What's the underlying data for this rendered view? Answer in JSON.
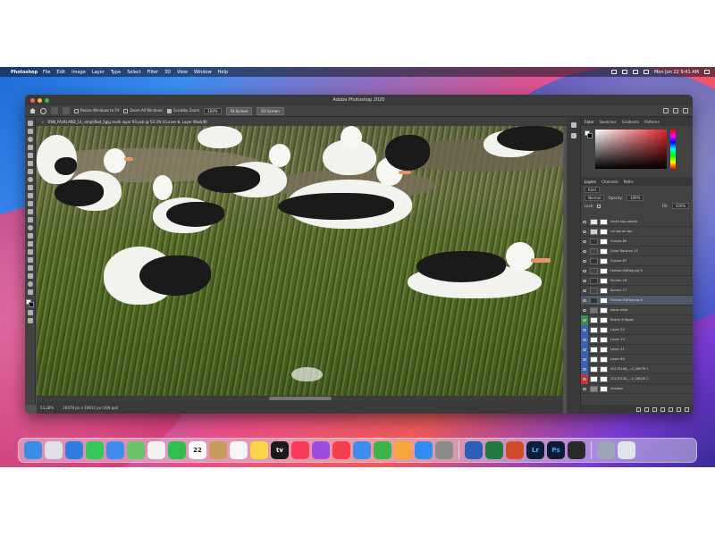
{
  "menubar": {
    "app_name": "Photoshop",
    "items": [
      "File",
      "Edit",
      "Image",
      "Layer",
      "Type",
      "Select",
      "Filter",
      "3D",
      "View",
      "Window",
      "Help"
    ],
    "clock": "Mon Jun 22  9:41 AM"
  },
  "window": {
    "title": "Adobe Photoshop 2020"
  },
  "options_bar": {
    "resize_windows": "Resize Windows to Fit",
    "zoom_all": "Zoom All Windows",
    "scrubby_zoom": "Scrubby Zoom",
    "zoom_level": "100%",
    "fit_screen": "Fit Screen",
    "fill_screen": "Fill Screen"
  },
  "document": {
    "tab_title": "DSN_FALKLAND_14_simplified_5gig multi layer 93.psb @ 53.3% (Curves 8, Layer Mask/8)",
    "status_zoom": "53.28%",
    "status_size": "20479 px x 10912 px (300 ppi)"
  },
  "color_panel": {
    "tabs": [
      "Color",
      "Swatches",
      "Gradients",
      "Patterns"
    ]
  },
  "layers_panel": {
    "tabs": [
      "Layers",
      "Channels",
      "Paths"
    ],
    "kind": "Kind",
    "blend_mode": "Normal",
    "opacity_label": "Opacity:",
    "opacity": "100%",
    "lock_label": "Lock:",
    "fill_label": "Fill:",
    "fill": "100%",
    "layers": [
      {
        "name": "small hop pieces",
        "color": "",
        "selected": false,
        "thumb": "#e8e8e8"
      },
      {
        "name": "curves on top",
        "color": "",
        "selected": false,
        "thumb": "#d0d0d0"
      },
      {
        "name": "Curves 69",
        "color": "",
        "selected": false,
        "thumb": "#333"
      },
      {
        "name": "Color Balance 13",
        "color": "",
        "selected": false,
        "thumb": "#444"
      },
      {
        "name": "Curves 67",
        "color": "",
        "selected": false,
        "thumb": "#333"
      },
      {
        "name": "Farbton/Sättigung 9",
        "color": "",
        "selected": false,
        "thumb": "#444"
      },
      {
        "name": "Kurven 18",
        "color": "",
        "selected": false,
        "thumb": "#333"
      },
      {
        "name": "Kurven 17",
        "color": "",
        "selected": false,
        "thumb": "#444"
      },
      {
        "name": "Farbton/Sättigung 8",
        "color": "",
        "selected": true,
        "thumb": "#333"
      },
      {
        "name": "extra birds",
        "color": "",
        "selected": false,
        "thumb": "#777"
      },
      {
        "name": "Ebene 6 Kopie",
        "color": "#3e8e4a",
        "selected": false,
        "thumb": "#fff"
      },
      {
        "name": "Layer 24",
        "color": "#3a63b8",
        "selected": false,
        "thumb": "#fff"
      },
      {
        "name": "Layer 23",
        "color": "#3a63b8",
        "selected": false,
        "thumb": "#fff"
      },
      {
        "name": "Layer 21",
        "color": "#3a63b8",
        "selected": false,
        "thumb": "#fff"
      },
      {
        "name": "Layer 60",
        "color": "#3a63b8",
        "selected": false,
        "thumb": "#fff"
      },
      {
        "name": "20170108_...0_28076 1",
        "color": "#3a63b8",
        "selected": false,
        "thumb": "#fff"
      },
      {
        "name": "20170108_...0_28026 1",
        "color": "#b83a3a",
        "selected": false,
        "thumb": "#fff"
      },
      {
        "name": "shadow",
        "color": "",
        "selected": false,
        "thumb": "#888"
      }
    ]
  },
  "dock": {
    "icons": [
      {
        "name": "finder-icon",
        "color": "#3a8ee6"
      },
      {
        "name": "launchpad-icon",
        "color": "#e0e0e6"
      },
      {
        "name": "safari-icon",
        "color": "#2f7de1"
      },
      {
        "name": "messages-icon",
        "color": "#34c759"
      },
      {
        "name": "mail-icon",
        "color": "#3f8cf0"
      },
      {
        "name": "maps-icon",
        "color": "#6cc26a"
      },
      {
        "name": "photos-icon",
        "color": "#f2f2f2"
      },
      {
        "name": "facetime-icon",
        "color": "#2fbf4f"
      },
      {
        "name": "calendar-icon",
        "color": "#ffffff"
      },
      {
        "name": "contacts-icon",
        "color": "#c79b5a"
      },
      {
        "name": "reminders-icon",
        "color": "#f6f6f6"
      },
      {
        "name": "notes-icon",
        "color": "#f7d44a"
      },
      {
        "name": "tv-icon",
        "color": "#1b1b1b"
      },
      {
        "name": "music-icon",
        "color": "#fa3d5a"
      },
      {
        "name": "podcasts-icon",
        "color": "#9b4de0"
      },
      {
        "name": "news-icon",
        "color": "#f43f4f"
      },
      {
        "name": "keynote-icon",
        "color": "#3f8cf0"
      },
      {
        "name": "numbers-icon",
        "color": "#3cb44b"
      },
      {
        "name": "pages-icon",
        "color": "#f7a53a"
      },
      {
        "name": "app-store-icon",
        "color": "#2f8cf0"
      },
      {
        "name": "system-preferences-icon",
        "color": "#8a8a8a"
      },
      {
        "name": "word-icon",
        "color": "#2b5fb8"
      },
      {
        "name": "excel-icon",
        "color": "#1f7a44"
      },
      {
        "name": "powerpoint-icon",
        "color": "#d14a2a"
      },
      {
        "name": "lightroom-icon",
        "color": "#0b1f3a"
      },
      {
        "name": "photoshop-icon",
        "color": "#0a1b33"
      },
      {
        "name": "final-cut-icon",
        "color": "#2a2a2a"
      },
      {
        "name": "preview-icon",
        "color": "#9aa6b6"
      },
      {
        "name": "trash-icon",
        "color": "#dfe4ea"
      }
    ],
    "calendar_day": "22",
    "tv_label": "tv",
    "lr_label": "Lr",
    "ps_label": "Ps"
  }
}
